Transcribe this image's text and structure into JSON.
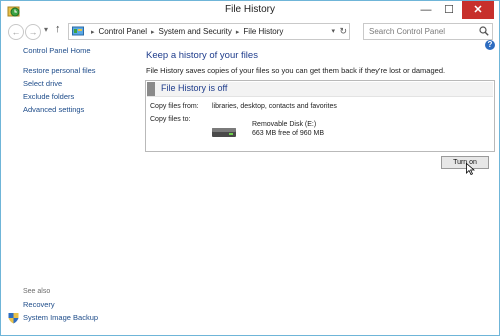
{
  "window": {
    "title": "File History"
  },
  "nav": {
    "back_glyph": "←",
    "forward_glyph": "→",
    "recent_glyph": "▾",
    "up_glyph": "↑",
    "breadcrumb": [
      "Control Panel",
      "System and Security",
      "File History"
    ],
    "breadcrumb_sep": "▸",
    "address_dropdown_glyph": "▾",
    "refresh_glyph": "↻",
    "search_placeholder": "Search Control Panel"
  },
  "window_controls": {
    "minimize": "—",
    "maximize": "☐",
    "close": "✕"
  },
  "sidebar": {
    "home": "Control Panel Home",
    "links": [
      "Restore personal files",
      "Select drive",
      "Exclude folders",
      "Advanced settings"
    ],
    "see_also_heading": "See also",
    "see_also": [
      "Recovery",
      "System Image Backup"
    ]
  },
  "main": {
    "help_glyph": "?",
    "heading": "Keep a history of your files",
    "description": "File History saves copies of your files so you can get them back if they're lost or damaged.",
    "status": "File History is off",
    "copy_from_label": "Copy files from:",
    "copy_from_value": "libraries, desktop, contacts and favorites",
    "copy_to_label": "Copy files to:",
    "drive_name": "Removable Disk (E:)",
    "drive_free": "663 MB free of 960 MB",
    "turn_on_button": "Turn on"
  },
  "icons": {
    "app": "file-history-icon",
    "address": "control-panel-icon",
    "search": "search-icon",
    "drive": "removable-disk-icon",
    "shield": "shield-icon",
    "help": "help-icon"
  },
  "colors": {
    "link": "#1e4c8a",
    "heading": "#1e3c8c",
    "close_button": "#c7302c",
    "window_border": "#6fb5d8"
  }
}
